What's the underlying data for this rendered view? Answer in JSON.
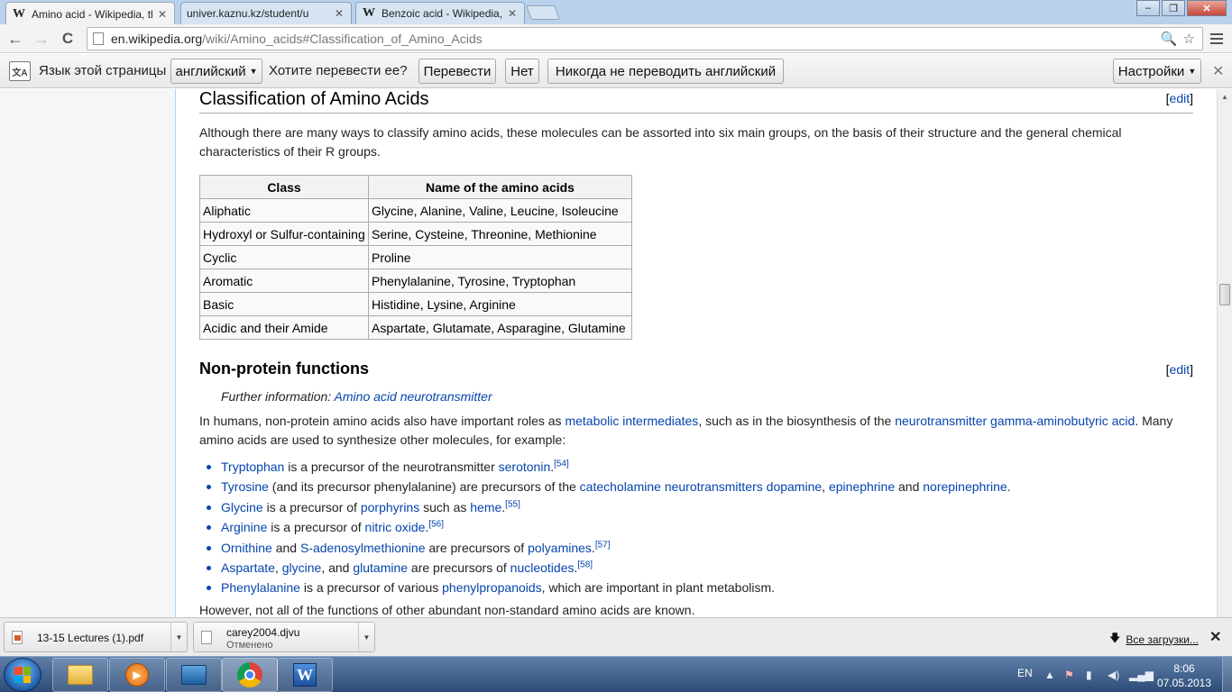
{
  "tabs": [
    {
      "title": "Amino acid - Wikipedia, th",
      "icon": "W"
    },
    {
      "title": "univer.kaznu.kz/student/u",
      "icon": ""
    },
    {
      "title": "Benzoic acid - Wikipedia, t",
      "icon": "W"
    }
  ],
  "window_controls": {
    "minimize": "–",
    "maximize": "❐",
    "close": "✕"
  },
  "toolbar": {
    "back": "←",
    "forward": "→",
    "reload": "C",
    "url_host": "en.wikipedia.org",
    "url_path": "/wiki/Amino_acids#Classification_of_Amino_Acids",
    "zoom_icon": "🔍",
    "star_icon": "☆"
  },
  "translate_bar": {
    "label_language": "Язык этой страницы",
    "language_value": "английский",
    "question": "Хотите перевести ее?",
    "translate_button": "Перевести",
    "no_button": "Нет",
    "never_button": "Никогда не переводить английский",
    "settings_button": "Настройки",
    "close": "✕"
  },
  "article": {
    "section1_title": "Classification of Amino Acids",
    "edit_label": "edit",
    "intro_text": "Although there are many ways to classify amino acids, these molecules can be assorted into six main groups, on the basis of their structure and the general chemical characteristics of their R groups.",
    "table": {
      "headers": [
        "Class",
        "Name of the amino acids"
      ],
      "rows": [
        [
          "Aliphatic",
          "Glycine, Alanine, Valine, Leucine, Isoleucine"
        ],
        [
          "Hydroxyl or Sulfur-containing",
          "Serine, Cysteine, Threonine, Methionine"
        ],
        [
          "Cyclic",
          "Proline"
        ],
        [
          "Aromatic",
          "Phenylalanine, Tyrosine, Tryptophan"
        ],
        [
          "Basic",
          "Histidine, Lysine, Arginine"
        ],
        [
          "Acidic and their Amide",
          "Aspartate, Glutamate, Asparagine, Glutamine"
        ]
      ]
    },
    "section2_title": "Non-protein functions",
    "further_prefix": "Further information:",
    "further_link": "Amino acid neurotransmitter",
    "para2_a": "In humans, non-protein amino acids also have important roles as ",
    "para2_link1": "metabolic intermediates",
    "para2_b": ", such as in the biosynthesis of the ",
    "para2_link2": "neurotransmitter gamma-aminobutyric acid",
    "para2_c": ". Many amino acids are used to synthesize other molecules, for example:",
    "list": [
      [
        {
          "t": "Tryptophan",
          "l": true
        },
        {
          "t": " is a precursor of the neurotransmitter "
        },
        {
          "t": "serotonin",
          "l": true
        },
        {
          "t": "."
        },
        {
          "t": "[54]",
          "s": true
        }
      ],
      [
        {
          "t": "Tyrosine",
          "l": true
        },
        {
          "t": " (and its precursor phenylalanine) are precursors of the "
        },
        {
          "t": "catecholamine",
          "l": true
        },
        {
          "t": " "
        },
        {
          "t": "neurotransmitters",
          "l": true
        },
        {
          "t": " "
        },
        {
          "t": "dopamine",
          "l": true
        },
        {
          "t": ", "
        },
        {
          "t": "epinephrine",
          "l": true
        },
        {
          "t": " and "
        },
        {
          "t": "norepinephrine",
          "l": true
        },
        {
          "t": "."
        }
      ],
      [
        {
          "t": "Glycine",
          "l": true
        },
        {
          "t": " is a precursor of "
        },
        {
          "t": "porphyrins",
          "l": true
        },
        {
          "t": " such as "
        },
        {
          "t": "heme",
          "l": true
        },
        {
          "t": "."
        },
        {
          "t": "[55]",
          "s": true
        }
      ],
      [
        {
          "t": "Arginine",
          "l": true
        },
        {
          "t": " is a precursor of "
        },
        {
          "t": "nitric oxide",
          "l": true
        },
        {
          "t": "."
        },
        {
          "t": "[56]",
          "s": true
        }
      ],
      [
        {
          "t": "Ornithine",
          "l": true
        },
        {
          "t": " and "
        },
        {
          "t": "S-adenosylmethionine",
          "l": true
        },
        {
          "t": " are precursors of "
        },
        {
          "t": "polyamines",
          "l": true
        },
        {
          "t": "."
        },
        {
          "t": "[57]",
          "s": true
        }
      ],
      [
        {
          "t": "Aspartate",
          "l": true
        },
        {
          "t": ", "
        },
        {
          "t": "glycine",
          "l": true
        },
        {
          "t": ", and "
        },
        {
          "t": "glutamine",
          "l": true
        },
        {
          "t": " are precursors of "
        },
        {
          "t": "nucleotides",
          "l": true
        },
        {
          "t": "."
        },
        {
          "t": "[58]",
          "s": true
        }
      ],
      [
        {
          "t": "Phenylalanine",
          "l": true
        },
        {
          "t": " is a precursor of various "
        },
        {
          "t": "phenylpropanoids",
          "l": true
        },
        {
          "t": ", which are important in plant metabolism."
        }
      ]
    ],
    "closing": "However, not all of the functions of other abundant non-standard amino acids are known."
  },
  "downloads": {
    "item1_name": "13-15 Lectures (1).pdf",
    "item2_name": "carey2004.djvu",
    "item2_status": "Отменено",
    "all_downloads": "Все загрузки...",
    "close": "✕"
  },
  "taskbar": {
    "lang": "EN",
    "time": "8:06",
    "date": "07.05.2013",
    "word_letter": "W"
  },
  "colors": {
    "link": "#0645ad",
    "taskbar": "#2d4b78",
    "tabstrip": "#b9d1ea"
  }
}
